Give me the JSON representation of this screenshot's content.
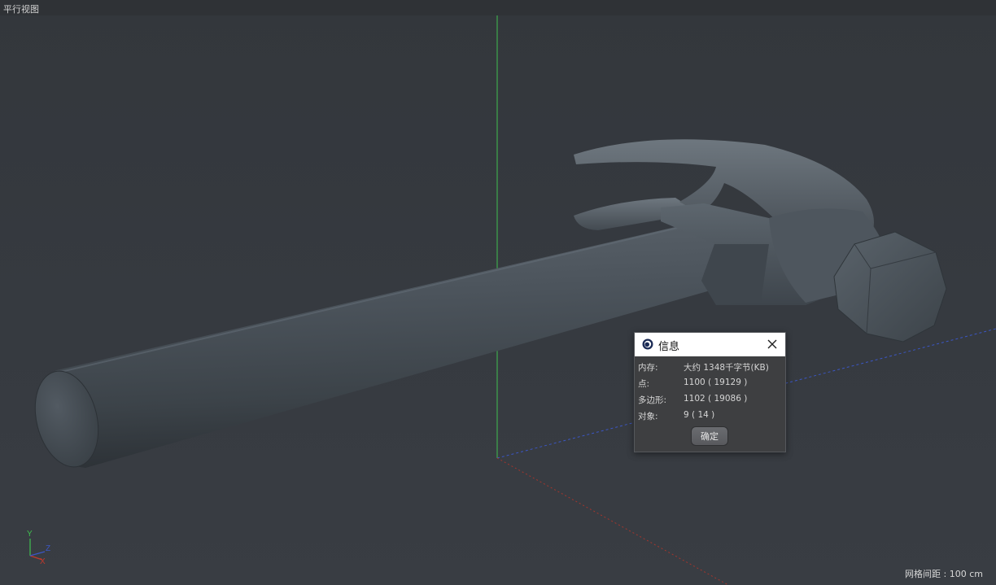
{
  "viewport": {
    "title": "平行视图",
    "grid_spacing": "网格间距 : 100 cm",
    "axes": {
      "y": "Y",
      "z": "Z",
      "x": "X"
    }
  },
  "dialog": {
    "title": "信息",
    "rows": [
      {
        "label": "内存:",
        "value": "大约 1348千字节(KB)"
      },
      {
        "label": "点:",
        "value": "1100 ( 19129 )"
      },
      {
        "label": "多边形:",
        "value": "1102 ( 19086 )"
      },
      {
        "label": "对象:",
        "value": "9 ( 14 )"
      }
    ],
    "ok_label": "确定"
  },
  "colors": {
    "viewport_bg": "#363a3f",
    "axis_y": "#3fbf4f",
    "axis_x": "#c0392b",
    "axis_z": "#3b56c4",
    "model": "#4a525a"
  },
  "icons": {
    "dialog_logo": "cinema4d-logo-icon",
    "dialog_close": "close-icon"
  }
}
